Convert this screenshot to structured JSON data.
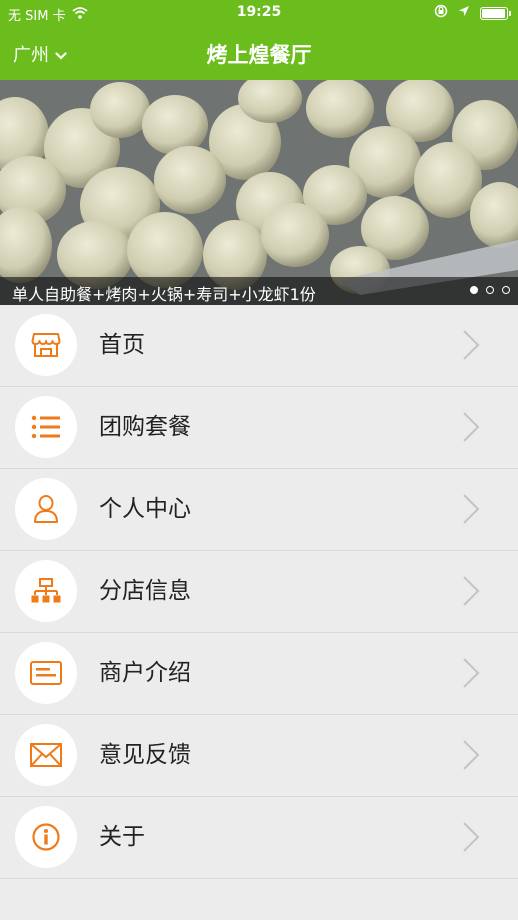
{
  "status": {
    "carrier": "无 SIM 卡",
    "time": "19:25"
  },
  "nav": {
    "city": "广州",
    "title": "烤上煌餐厅"
  },
  "banner": {
    "caption": "单人自助餐+烤肉+火锅+寿司+小龙虾1份",
    "slides": 3,
    "active_slide": 1
  },
  "menu": {
    "items": [
      {
        "label": "首页",
        "icon": "storefront-icon"
      },
      {
        "label": "团购套餐",
        "icon": "list-icon"
      },
      {
        "label": "个人中心",
        "icon": "person-icon"
      },
      {
        "label": "分店信息",
        "icon": "branch-tree-icon"
      },
      {
        "label": "商户介绍",
        "icon": "document-icon"
      },
      {
        "label": "意见反馈",
        "icon": "envelope-icon"
      },
      {
        "label": "关于",
        "icon": "info-icon"
      }
    ]
  },
  "colors": {
    "header": "#6bbd1d",
    "icon_accent": "#f07a18"
  }
}
